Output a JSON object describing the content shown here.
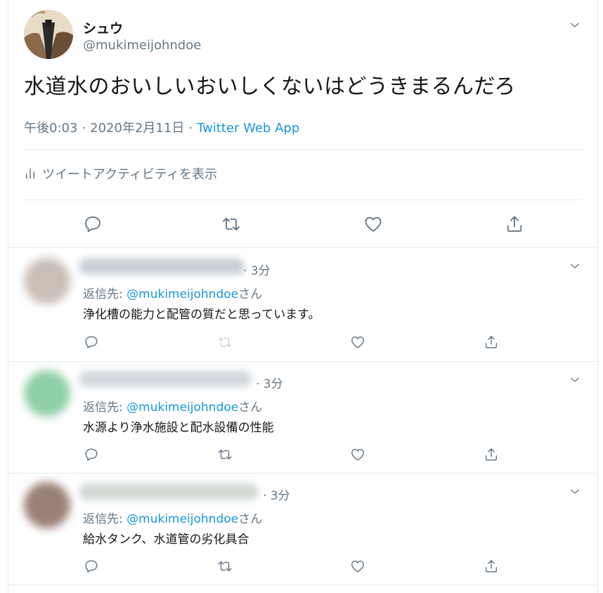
{
  "main_tweet": {
    "display_name": "シュウ",
    "handle": "@mukimeijohndoe",
    "text": "水道水のおいしいおいしくないはどうきまるんだろ",
    "time": "午後0:03",
    "date": "2020年2月11日",
    "separator": "·",
    "source": "Twitter Web App",
    "activity_label": "ツイートアクティビティを表示"
  },
  "replies": [
    {
      "time": "· 3分",
      "reply_prefix": "返信先: ",
      "reply_mention": "@mukimeijohndoe",
      "reply_suffix": "さん",
      "text": "浄化槽の能力と配管の質だと思っています。",
      "avatar_color": "#c9bfb7"
    },
    {
      "time": "· 3分",
      "reply_prefix": "返信先: ",
      "reply_mention": "@mukimeijohndoe",
      "reply_suffix": "さん",
      "text": "水源より浄水施設と配水設備の性能",
      "avatar_color": "#8fcfa8"
    },
    {
      "time": "· 3分",
      "reply_prefix": "返信先: ",
      "reply_mention": "@mukimeijohndoe",
      "reply_suffix": "さん",
      "text": "給水タンク、水道管の劣化具合",
      "avatar_color": "#9a8178"
    }
  ],
  "colors": {
    "text": "#14171a",
    "secondary": "#657786",
    "link": "#1b95e0",
    "divider": "#e6ecf0"
  },
  "icons": [
    "chevron-down-icon",
    "reply-icon",
    "retweet-icon",
    "like-icon",
    "share-icon",
    "activity-bars-icon"
  ]
}
